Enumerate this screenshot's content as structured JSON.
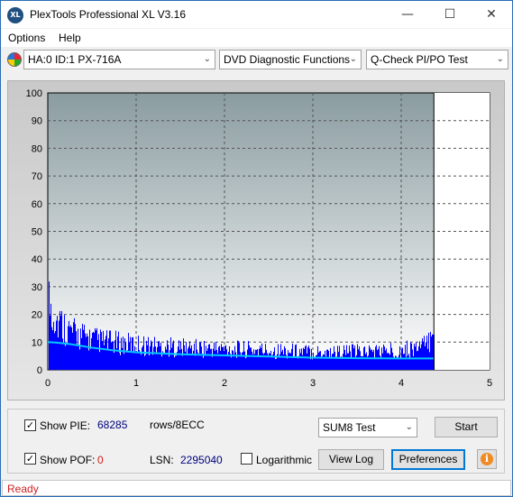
{
  "window": {
    "title": "PlexTools Professional XL V3.16",
    "logo_text": "XL",
    "minimize_icon": "—",
    "maximize_icon": "☐",
    "close_icon": "✕"
  },
  "menu": {
    "options": "Options",
    "help": "Help"
  },
  "toolbar": {
    "drive": "HA:0 ID:1  PX-716A",
    "function": "DVD Diagnostic Functions",
    "test": "Q-Check PI/PO Test",
    "dropdown_arrow": "⌄"
  },
  "chart_data": {
    "type": "bar",
    "xlim": [
      0,
      5
    ],
    "ylim": [
      0,
      100
    ],
    "x_ticks": [
      "0",
      "1",
      "2",
      "3",
      "4",
      "5"
    ],
    "y_ticks": [
      "0",
      "10",
      "20",
      "30",
      "40",
      "50",
      "60",
      "70",
      "80",
      "90",
      "100"
    ],
    "data_end_x": 4.37,
    "grid": true,
    "series": [
      {
        "color": "#0000ff",
        "x": [
          0.0,
          0.05,
          0.1,
          0.2,
          0.3,
          0.5,
          0.7,
          1.0,
          1.5,
          2.0,
          2.5,
          3.0,
          3.5,
          4.0,
          4.3,
          4.37
        ],
        "values": [
          26,
          22,
          18,
          15,
          13,
          11,
          10,
          9,
          8,
          7.5,
          7,
          6.5,
          6.5,
          7,
          9,
          19
        ]
      },
      {
        "color": "#00c8ff",
        "x": [
          0.0,
          0.1,
          0.25,
          0.5,
          0.75,
          1.0,
          1.5,
          2.0,
          2.5,
          3.0,
          3.5,
          4.0,
          4.37
        ],
        "values": [
          10,
          9.8,
          9.3,
          8.0,
          7.0,
          6.3,
          5.6,
          5.2,
          4.8,
          4.4,
          4.2,
          4.1,
          4.1
        ]
      }
    ]
  },
  "controls": {
    "show_pie_label": "Show PIE:",
    "pie_value": "68285",
    "pie_unit": "rows/8ECC",
    "show_pof_label": "Show POF:",
    "pof_value": "0",
    "lsn_label": "LSN:",
    "lsn_value": "2295040",
    "logarithmic_label": "Logarithmic",
    "test_select": "SUM8 Test",
    "start_label": "Start",
    "view_log_label": "View Log",
    "preferences_label": "Preferences",
    "info_icon_text": "i",
    "check_mark": "✓",
    "pie_color": "#000080",
    "pof_color": "#d02020"
  },
  "status": {
    "text": "Ready"
  }
}
